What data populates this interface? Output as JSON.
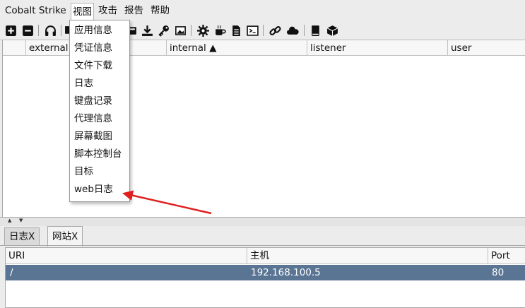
{
  "menubar": {
    "items": [
      "Cobalt Strike",
      "视图",
      "攻击",
      "报告",
      "帮助"
    ]
  },
  "toolbar": {
    "icons": [
      "plus-icon",
      "minus-icon",
      "headphones-icon",
      "monitor-icon",
      "gear-icon",
      "download-icon",
      "key-icon",
      "image-icon",
      "settings-gear-icon",
      "coffee-icon",
      "document-icon",
      "terminal-icon",
      "link-icon",
      "cloud-icon",
      "book-icon",
      "cube-icon"
    ]
  },
  "top_table": {
    "columns": [
      "external",
      "internal ▲",
      "listener",
      "user"
    ]
  },
  "view_menu": {
    "items": [
      "应用信息",
      "凭证信息",
      "文件下载",
      "日志",
      "键盘记录",
      "代理信息",
      "屏幕截图",
      "脚本控制台",
      "目标",
      "web日志"
    ]
  },
  "tabs": [
    {
      "label": "日志X"
    },
    {
      "label": "网站X"
    }
  ],
  "bottom_table": {
    "columns": [
      "URI",
      "主机",
      "Port"
    ],
    "rows": [
      {
        "uri": "/",
        "host": "192.168.100.5",
        "port": "80"
      }
    ]
  },
  "colors": {
    "selected_row": "#5a7594",
    "annotation_arrow": "#e02020"
  }
}
